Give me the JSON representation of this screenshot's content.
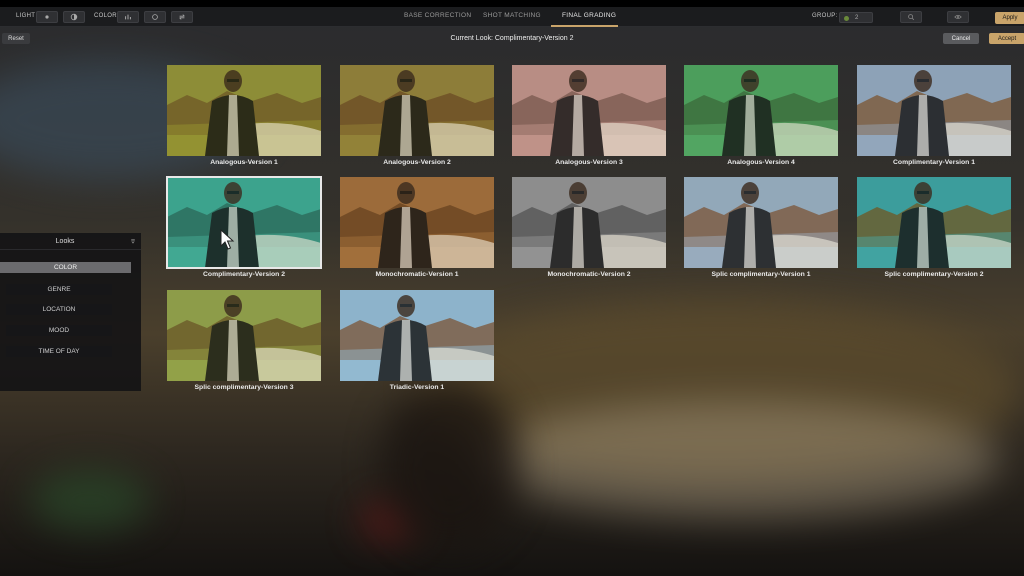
{
  "toolbar": {
    "light_label": "LIGHT",
    "color_label": "COLOR",
    "tabs": [
      {
        "label": "BASE CORRECTION",
        "active": false
      },
      {
        "label": "SHOT MATCHING",
        "active": false
      },
      {
        "label": "FINAL GRADING",
        "active": true
      }
    ],
    "group_label": "GROUP:",
    "group_value": "2",
    "apply_label": "Apply",
    "accent_color": "#c9a46a"
  },
  "subbar": {
    "reset_label": "Reset",
    "current_look": "Current Look: Complimentary-Version 2",
    "cancel_label": "Cancel",
    "accept_label": "Accept"
  },
  "looks_panel": {
    "title": "Looks",
    "categories": [
      {
        "label": "COLOR",
        "active": true
      },
      {
        "label": "GENRE",
        "active": false
      },
      {
        "label": "LOCATION",
        "active": false
      },
      {
        "label": "MOOD",
        "active": false
      },
      {
        "label": "TIME OF DAY",
        "active": false
      }
    ]
  },
  "looks": [
    {
      "name": "Analogous-Version 1",
      "sky": "#8a8a3a",
      "ground": "#6e5a2a",
      "tint": "#9c9a2e"
    },
    {
      "name": "Analogous-Version 2",
      "sky": "#8a7a3a",
      "ground": "#6b4c26",
      "tint": "#9a8a3a"
    },
    {
      "name": "Analogous-Version 3",
      "sky": "#b58a82",
      "ground": "#7a5a50",
      "tint": "#c89a8e"
    },
    {
      "name": "Analogous-Version 4",
      "sky": "#4a9a5a",
      "ground": "#3a6a3a",
      "tint": "#5ab06a"
    },
    {
      "name": "Complimentary-Version 1",
      "sky": "#8aa0b5",
      "ground": "#7a5a3a",
      "tint": "#9aaac0"
    },
    {
      "name": "Complimentary-Version 2",
      "sky": "#3aa08a",
      "ground": "#2a6a5a",
      "tint": "#4ab09a",
      "selected": true
    },
    {
      "name": "Monochromatic-Version 1",
      "sky": "#9a6a3a",
      "ground": "#6a4422",
      "tint": "#a8743e"
    },
    {
      "name": "Monochromatic-Version 2",
      "sky": "#8a8a8a",
      "ground": "#555555",
      "tint": "#9a9a9a"
    },
    {
      "name": "Splic complimentary-Version 1",
      "sky": "#8fa6b8",
      "ground": "#7a5a40",
      "tint": "#a0b0c0"
    },
    {
      "name": "Splic complimentary-Version 2",
      "sky": "#3a9a9a",
      "ground": "#6a5a2a",
      "tint": "#4aaaa8"
    },
    {
      "name": "Splic complimentary-Version 3",
      "sky": "#8a9a4a",
      "ground": "#6a5a2a",
      "tint": "#9aa84a"
    },
    {
      "name": "Triadic-Version 1",
      "sky": "#8ab0c8",
      "ground": "#7a5a40",
      "tint": "#9ac0d8"
    }
  ]
}
